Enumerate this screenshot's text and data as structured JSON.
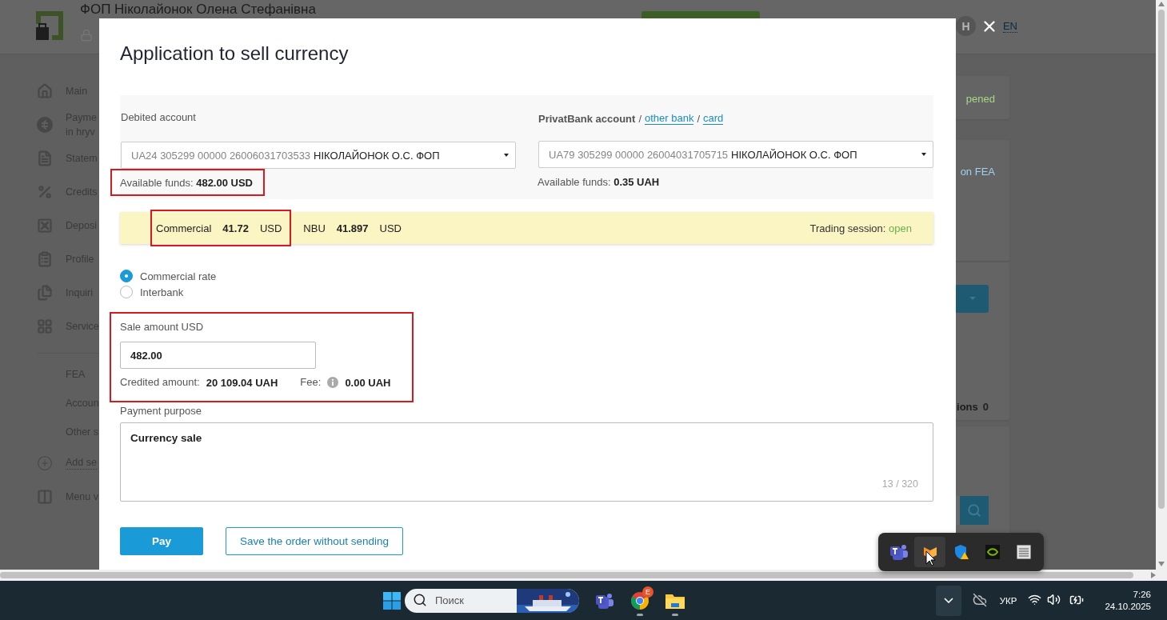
{
  "app": {
    "org_name": "ФОП Ніколайонок Олена Стефанівна",
    "avatar": "Н",
    "language": "EN",
    "nav": [
      {
        "label": "Main"
      },
      {
        "label": "Payme",
        "second_line": "in hryv"
      },
      {
        "label": "Statem"
      },
      {
        "label": "Credits"
      },
      {
        "label": "Deposi"
      },
      {
        "label": "Profile"
      },
      {
        "label": "Inquiri"
      },
      {
        "label": "Service"
      }
    ],
    "nav_extra": [
      {
        "label": "FEA",
        "kind": "plain"
      },
      {
        "label": "Accoun",
        "kind": "plain"
      },
      {
        "label": "Other s",
        "kind": "plain"
      },
      {
        "label": "Add se",
        "kind": "add"
      },
      {
        "label": "Menu v",
        "kind": "toggle"
      }
    ],
    "cards": [
      {
        "kind": "status",
        "text": "pened"
      },
      {
        "kind": "link",
        "text": "on FEA"
      },
      {
        "kind": "actions",
        "text": "ions",
        "count": "0"
      },
      {
        "kind": "search"
      }
    ]
  },
  "modal": {
    "title": "Application to sell currency",
    "debit": {
      "label": "Debited account",
      "iban": "UA24 305299 00000 26006031703533",
      "owner": "НІКОЛАЙОНОК О.С. ФОП",
      "funds_label": "Available funds:",
      "funds": "482.00 USD",
      "highlighted": true
    },
    "credit": {
      "label": "PrivatBank account",
      "separator": "/",
      "links": [
        "other bank",
        "card"
      ],
      "iban": "UA79 305299 00000 26004031705715",
      "owner": "НІКОЛАЙОНОК О.С. ФОП",
      "funds_label": "Available funds:",
      "funds": "0.35 UAH",
      "highlighted": false
    },
    "rates": [
      {
        "name": "Commercial",
        "value": "41.72",
        "currency": "USD",
        "highlighted": true
      },
      {
        "name": "NBU",
        "value": "41.897",
        "currency": "USD",
        "highlighted": false
      }
    ],
    "session": {
      "label": "Trading session:",
      "status": "open"
    },
    "rate_options": [
      {
        "label": "Commercial rate",
        "selected": true
      },
      {
        "label": "Interbank",
        "selected": false
      }
    ],
    "sale": {
      "label": "Sale amount USD",
      "value": "482.00",
      "credited_label": "Credited amount:",
      "credited": "20 109.04 UAH",
      "fee_label": "Fee:",
      "fee": "0.00 UAH",
      "highlighted": true
    },
    "purpose": {
      "label": "Payment purpose",
      "value": "Currency sale",
      "counter": "13 / 320"
    },
    "buttons": [
      {
        "label": "Pay",
        "kind": "primary"
      },
      {
        "label": "Save the order without sending",
        "kind": "secondary"
      }
    ]
  },
  "taskbar": {
    "search_placeholder": "Поиск",
    "apps": [
      {
        "kind": "teams",
        "running": false
      },
      {
        "kind": "chrome",
        "running": true,
        "badge": "E"
      },
      {
        "kind": "explorer",
        "running": true
      }
    ],
    "language": "УКР",
    "time": "7:26",
    "date": "24.10.2025",
    "tray": [
      {
        "kind": "teams",
        "selected": false
      },
      {
        "kind": "orange",
        "selected": true
      },
      {
        "kind": "shield",
        "selected": false
      },
      {
        "kind": "nvidia",
        "selected": false
      },
      {
        "kind": "monitor",
        "selected": false
      }
    ]
  }
}
